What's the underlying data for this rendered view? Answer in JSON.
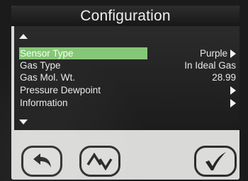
{
  "screen": {
    "title": "Configuration"
  },
  "menu": {
    "rows": [
      {
        "label": "Sensor Type",
        "value": "Purple",
        "has_submenu": true,
        "selected": true
      },
      {
        "label": "Gas Type",
        "value": "In Ideal Gas",
        "has_submenu": false,
        "selected": false
      },
      {
        "label": "Gas Mol. Wt.",
        "value": "28.99",
        "has_submenu": false,
        "selected": false
      },
      {
        "label": "Pressure Dewpoint",
        "value": "",
        "has_submenu": true,
        "selected": false
      },
      {
        "label": "Information",
        "value": "",
        "has_submenu": true,
        "selected": false
      }
    ]
  },
  "icons": {
    "scroll_up": "triangle-up-icon",
    "scroll_down": "triangle-down-icon",
    "back": "back-arrow-icon",
    "up_down": "up-down-arrows-icon",
    "confirm": "checkmark-icon",
    "submenu": "triangle-right-icon"
  },
  "colors": {
    "selection_highlight": "#86c777",
    "title_bar": "#1f1f1f",
    "panel_background": "#242424",
    "button_bar": "#d9dad8"
  }
}
